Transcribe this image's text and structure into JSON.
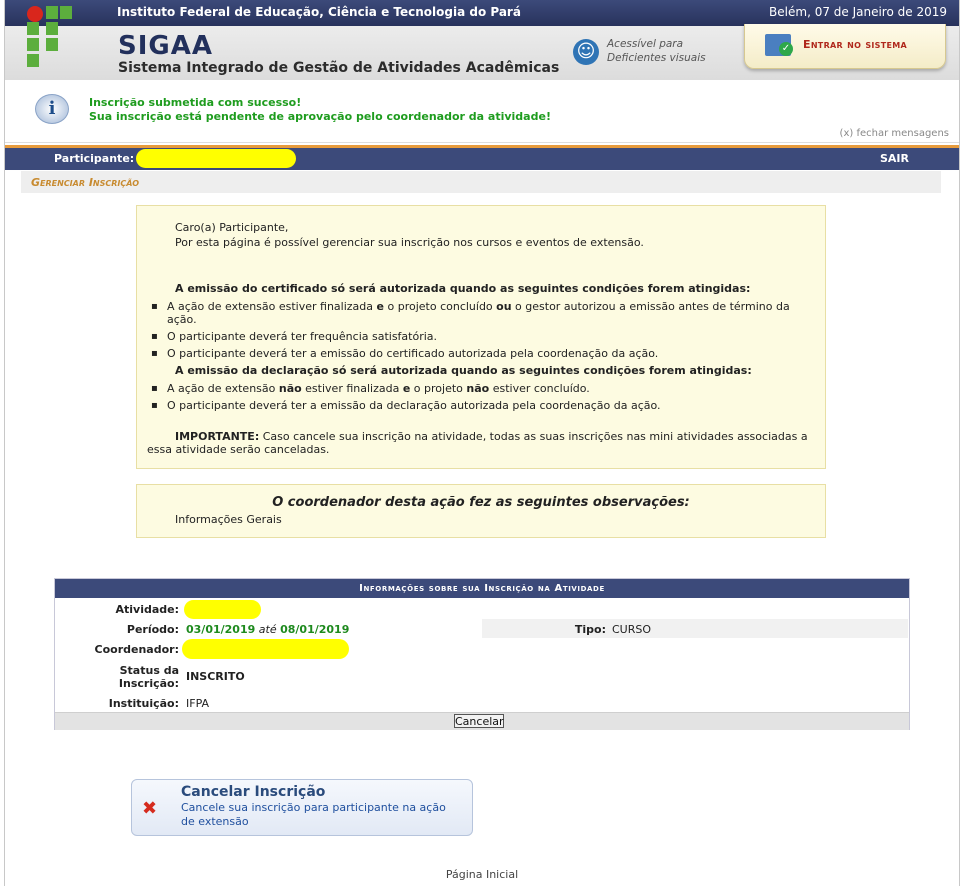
{
  "header": {
    "institution": "Instituto Federal de Educação, Ciência e Tecnologia do Pará",
    "date": "Belém, 07 de Janeiro de 2019",
    "app_title": "SIGAA",
    "app_subtitle": "Sistema Integrado de Gestão de Atividades Acadêmicas",
    "accessibility_line1": "Acessível para",
    "accessibility_line2": "Deficientes visuais",
    "login_label": "Entrar no sistema"
  },
  "messages": {
    "line1": "Inscrição submetida com sucesso!",
    "line2": "Sua inscrição está pendente de aprovação pelo coordenador da atividade!",
    "close_label": "(x) fechar mensagens"
  },
  "participant_bar": {
    "label": "Participante:",
    "logout": "SAIR"
  },
  "breadcrumb": "Gerenciar Inscrição",
  "info": {
    "greeting": "Caro(a) Participante,",
    "intro": "Por esta página é possível gerenciar sua inscrição nos cursos e eventos de extensão.",
    "cert_heading": "A emissão do certificado só será autorizada quando as seguintes condições forem atingidas:",
    "cert_item1_a": "A ação de extensão estiver finalizada ",
    "cert_item1_b": "e",
    "cert_item1_c": " o projeto concluído ",
    "cert_item1_d": "ou",
    "cert_item1_e": " o gestor autorizou a emissão antes de término da ação.",
    "cert_item2": "O participante deverá ter frequência satisfatória.",
    "cert_item3": "O participante deverá ter a emissão do certificado autorizada pela coordenação da ação.",
    "decl_heading": "A emissão da declaração só será autorizada quando as seguintes condições forem atingidas:",
    "decl_item1_a": "A ação de extensão ",
    "decl_item1_b": "não",
    "decl_item1_c": " estiver finalizada ",
    "decl_item1_d": "e",
    "decl_item1_e": " o projeto ",
    "decl_item1_f": "não",
    "decl_item1_g": " estiver concluído.",
    "decl_item2": "O participante deverá ter a emissão da declaração autorizada pela coordenação da ação.",
    "important_label": "IMPORTANTE:",
    "important_text": " Caso cancele sua inscrição na atividade, todas as suas inscrições nas mini atividades associadas a essa atividade serão canceladas."
  },
  "observations": {
    "title": "O coordenador desta ação fez as seguintes observações:",
    "body": "Informações Gerais"
  },
  "registration": {
    "title": "Informações sobre sua Inscrição na Atividade",
    "activity_label": "Atividade:",
    "period_label": "Período:",
    "period_start": "03/01/2019",
    "period_sep": "até",
    "period_end": "08/01/2019",
    "type_label": "Tipo:",
    "type_value": "CURSO",
    "coordinator_label": "Coordenador:",
    "status_label_1": "Status da",
    "status_label_2": "Inscrição:",
    "status_value": "INSCRITO",
    "institution_label": "Instituição:",
    "institution_value": "IFPA",
    "cancel_button": "Cancelar"
  },
  "action_card": {
    "title": "Cancelar Inscrição",
    "description": "Cancele sua inscrição para participante na ação de extensão"
  },
  "footer": {
    "home_link": "Página Inicial"
  },
  "colors": {
    "header_blue": "#3c4a7a",
    "success_green": "#1e9c1e",
    "redaction_yellow": "#ffff00",
    "info_bg": "#fdfbe1"
  }
}
